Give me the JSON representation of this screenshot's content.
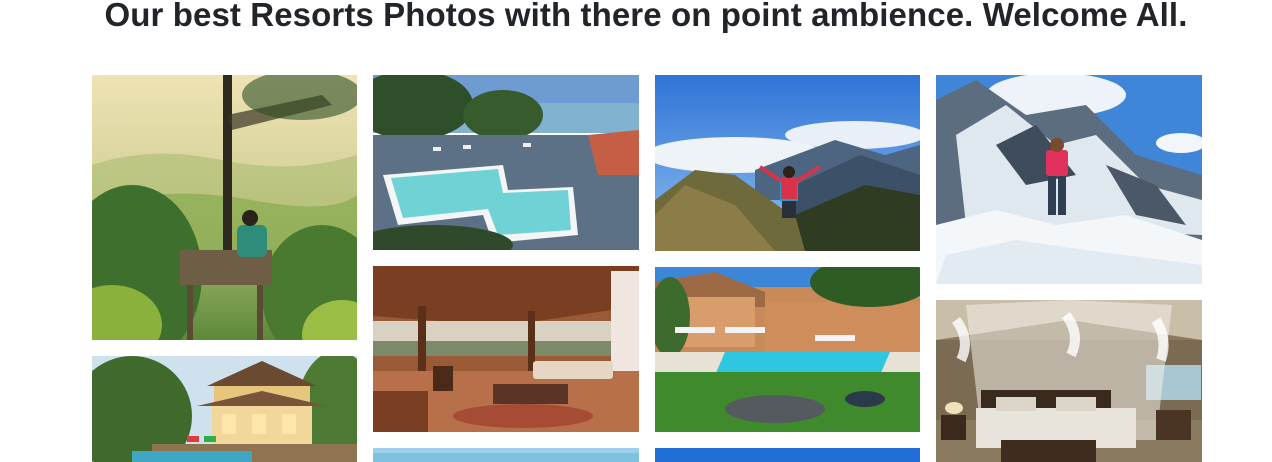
{
  "page": {
    "heading": "Our best Resorts Photos with there on point ambience. Welcome All."
  },
  "gallery": {
    "photos": [
      {
        "subject": "treehouse-forest-view"
      },
      {
        "subject": "villa-pool-at-dusk"
      },
      {
        "subject": "seaside-pool-terrace"
      },
      {
        "subject": "safari-veranda-lounge"
      },
      {
        "subject": "ocean-water-strip"
      },
      {
        "subject": "mountain-hiker-summit"
      },
      {
        "subject": "resort-pool-courtyard"
      },
      {
        "subject": "blue-sky-strip"
      },
      {
        "subject": "snow-mountain-climber"
      },
      {
        "subject": "canopy-bed-tent-room"
      }
    ]
  },
  "colors": {
    "heading_text": "#212529",
    "background": "#ffffff"
  }
}
